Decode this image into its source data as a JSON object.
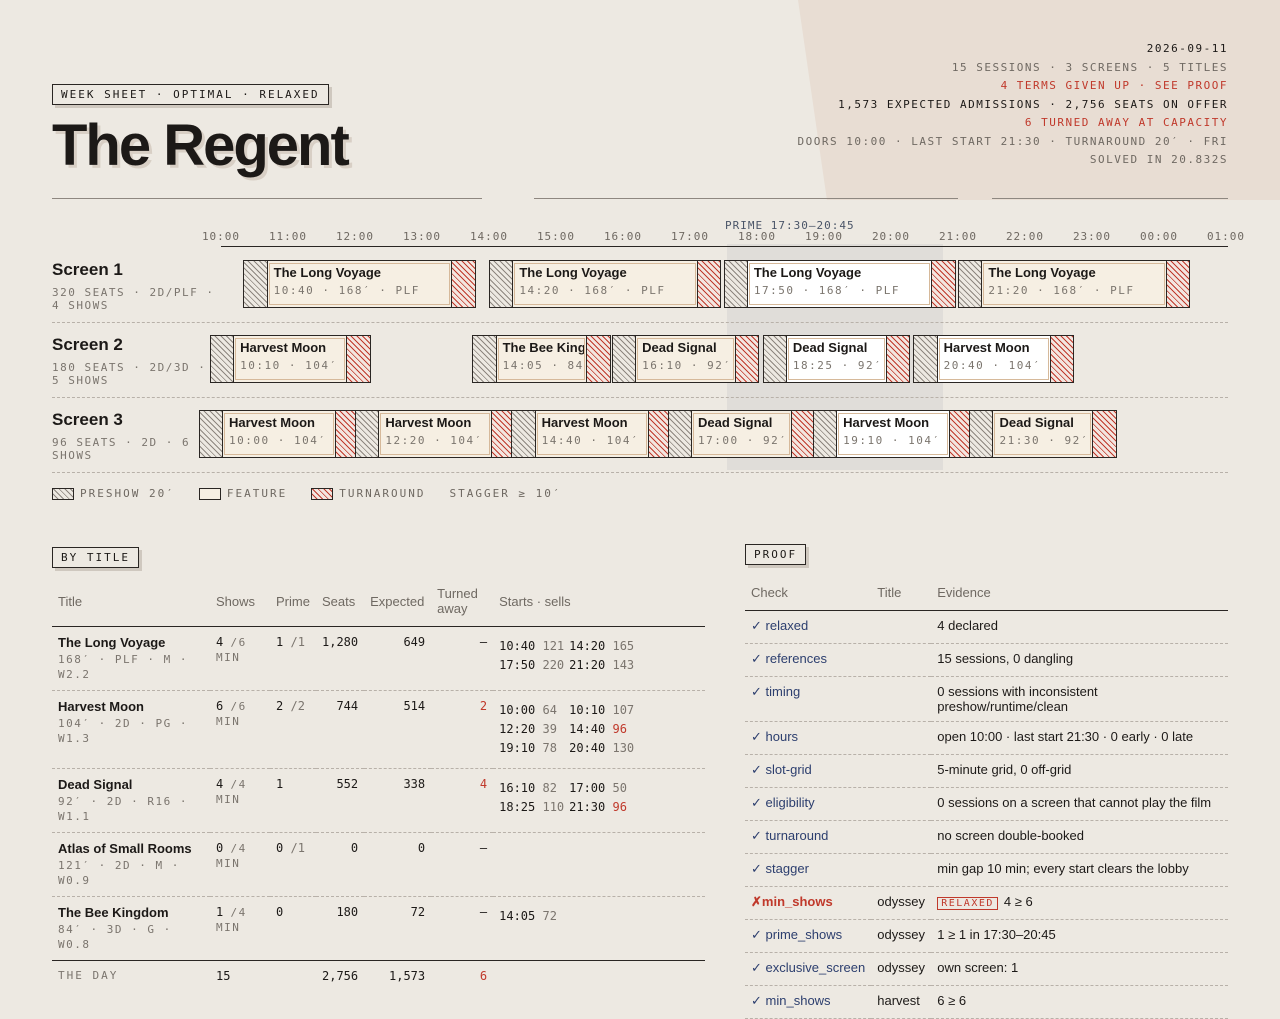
{
  "header": {
    "stamp": "WEEK SHEET · OPTIMAL · RELAXED",
    "title": "The Regent",
    "meta": [
      {
        "text": "2026-09-11",
        "tone": "dark"
      },
      {
        "text": "15 SESSIONS · 3 SCREENS · 5 TITLES",
        "tone": "grey"
      },
      {
        "text": "4 TERMS GIVEN UP · SEE PROOF",
        "tone": "red"
      },
      {
        "text": "1,573 EXPECTED ADMISSIONS · 2,756 SEATS ON OFFER",
        "tone": "mixed"
      },
      {
        "text": "6 TURNED AWAY AT CAPACITY",
        "tone": "red"
      },
      {
        "text": "DOORS 10:00 · LAST START 21:30 · TURNAROUND 20′ · FRI",
        "tone": "grey"
      },
      {
        "text": "SOLVED IN 20.832S",
        "tone": "grey"
      }
    ]
  },
  "timeline": {
    "ticks": [
      "10:00",
      "11:00",
      "12:00",
      "13:00",
      "14:00",
      "15:00",
      "16:00",
      "17:00",
      "18:00",
      "19:00",
      "20:00",
      "21:00",
      "22:00",
      "23:00",
      "00:00",
      "01:00"
    ],
    "prime_label": "PRIME 17:30–20:45",
    "screens": [
      {
        "name": "Screen 1",
        "info": "320 SEATS · 2D/PLF · 4 SHOWS",
        "sessions": [
          {
            "title": "The Long Voyage",
            "sub": "10:40 · 168′ · PLF",
            "start": "10:40",
            "runtime": 168
          },
          {
            "title": "The Long Voyage",
            "sub": "14:20 · 168′ · PLF",
            "start": "14:20",
            "runtime": 168
          },
          {
            "title": "The Long Voyage",
            "sub": "17:50 · 168′ · PLF",
            "start": "17:50",
            "runtime": 168
          },
          {
            "title": "The Long Voyage",
            "sub": "21:20 · 168′ · PLF",
            "start": "21:20",
            "runtime": 168
          }
        ]
      },
      {
        "name": "Screen 2",
        "info": "180 SEATS · 2D/3D · 5 SHOWS",
        "sessions": [
          {
            "title": "Harvest Moon",
            "sub": "10:10 · 104′",
            "start": "10:10",
            "runtime": 104
          },
          {
            "title": "The Bee King",
            "sub": "14:05 · 84′",
            "start": "14:05",
            "runtime": 84
          },
          {
            "title": "Dead Signal",
            "sub": "16:10 · 92′",
            "start": "16:10",
            "runtime": 92
          },
          {
            "title": "Dead Signal",
            "sub": "18:25 · 92′",
            "start": "18:25",
            "runtime": 92
          },
          {
            "title": "Harvest Moon",
            "sub": "20:40 · 104′",
            "start": "20:40",
            "runtime": 104
          }
        ]
      },
      {
        "name": "Screen 3",
        "info": "96 SEATS · 2D · 6 SHOWS",
        "sessions": [
          {
            "title": "Harvest Moon",
            "sub": "10:00 · 104′",
            "start": "10:00",
            "runtime": 104
          },
          {
            "title": "Harvest Moon",
            "sub": "12:20 · 104′",
            "start": "12:20",
            "runtime": 104
          },
          {
            "title": "Harvest Moon",
            "sub": "14:40 · 104′",
            "start": "14:40",
            "runtime": 104
          },
          {
            "title": "Dead Signal",
            "sub": "17:00 · 92′",
            "start": "17:00",
            "runtime": 92
          },
          {
            "title": "Harvest Moon",
            "sub": "19:10 · 104′",
            "start": "19:10",
            "runtime": 104
          },
          {
            "title": "Dead Signal",
            "sub": "21:30 · 92′",
            "start": "21:30",
            "runtime": 92
          }
        ]
      }
    ],
    "legend": {
      "preshow": "PRESHOW 20′",
      "feature": "FEATURE",
      "turnaround": "TURNAROUND",
      "stagger": "STAGGER ≥ 10′"
    }
  },
  "by_title": {
    "label": "BY TITLE",
    "columns": {
      "title": "Title",
      "shows": "Shows",
      "prime": "Prime",
      "seats": "Seats",
      "expected": "Expected",
      "turned": "Turned away",
      "starts": "Starts · sells"
    },
    "rows": [
      {
        "title": "The Long Voyage",
        "sub": "168′ · PLF · M · W2.2",
        "shows": "4",
        "shows_min": "/6 MIN",
        "prime": "1",
        "prime_min": "/1",
        "seats": "1,280",
        "expected": "649",
        "turned": "–",
        "starts": [
          [
            "10:40",
            "121"
          ],
          [
            "14:20",
            "165"
          ],
          [
            "17:50",
            "220"
          ],
          [
            "21:20",
            "143"
          ]
        ]
      },
      {
        "title": "Harvest Moon",
        "sub": "104′ · 2D · PG · W1.3",
        "shows": "6",
        "shows_min": "/6 MIN",
        "prime": "2",
        "prime_min": "/2",
        "seats": "744",
        "expected": "514",
        "turned": "2",
        "starts": [
          [
            "10:00",
            "64"
          ],
          [
            "10:10",
            "107"
          ],
          [
            "12:20",
            "39"
          ],
          [
            "14:40",
            "96"
          ],
          [
            "19:10",
            "78"
          ],
          [
            "20:40",
            "130"
          ]
        ]
      },
      {
        "title": "Dead Signal",
        "sub": "92′ · 2D · R16 · W1.1",
        "shows": "4",
        "shows_min": "/4 MIN",
        "prime": "1",
        "prime_min": "",
        "seats": "552",
        "expected": "338",
        "turned": "4",
        "starts": [
          [
            "16:10",
            "82"
          ],
          [
            "17:00",
            "50"
          ],
          [
            "18:25",
            "110"
          ],
          [
            "21:30",
            "96"
          ]
        ]
      },
      {
        "title": "Atlas of Small Rooms",
        "sub": "121′ · 2D · M · W0.9",
        "shows": "0",
        "shows_min": "/4 MIN",
        "prime": "0",
        "prime_min": "/1",
        "seats": "0",
        "expected": "0",
        "turned": "–",
        "starts": []
      },
      {
        "title": "The Bee Kingdom",
        "sub": "84′ · 3D · G · W0.8",
        "shows": "1",
        "shows_min": "/4 MIN",
        "prime": "0",
        "prime_min": "",
        "seats": "180",
        "expected": "72",
        "turned": "–",
        "starts": [
          [
            "14:05",
            "72"
          ]
        ]
      }
    ],
    "total": {
      "label": "THE DAY",
      "shows": "15",
      "seats": "2,756",
      "expected": "1,573",
      "turned": "6"
    }
  },
  "proof": {
    "label": "PROOF",
    "columns": {
      "check": "Check",
      "title": "Title",
      "evidence": "Evidence"
    },
    "rows": [
      {
        "ok": true,
        "check": "relaxed",
        "title": "",
        "evidence": "4 declared"
      },
      {
        "ok": true,
        "check": "references",
        "title": "",
        "evidence": "15 sessions, 0 dangling"
      },
      {
        "ok": true,
        "check": "timing",
        "title": "",
        "evidence": "0 sessions with inconsistent preshow/runtime/clean"
      },
      {
        "ok": true,
        "check": "hours",
        "title": "",
        "evidence": "open 10:00 · last start 21:30 · 0 early · 0 late"
      },
      {
        "ok": true,
        "check": "slot-grid",
        "title": "",
        "evidence": "5-minute grid, 0 off-grid"
      },
      {
        "ok": true,
        "check": "eligibility",
        "title": "",
        "evidence": "0 sessions on a screen that cannot play the film"
      },
      {
        "ok": true,
        "check": "turnaround",
        "title": "",
        "evidence": "no screen double-booked"
      },
      {
        "ok": true,
        "check": "stagger",
        "title": "",
        "evidence": "min gap 10 min; every start clears the lobby"
      },
      {
        "ok": false,
        "check": "min_shows",
        "title": "odyssey",
        "badge": "RELAXED",
        "evidence": "4 ≥ 6"
      },
      {
        "ok": true,
        "check": "prime_shows",
        "title": "odyssey",
        "evidence": "1 ≥ 1 in 17:30–20:45"
      },
      {
        "ok": true,
        "check": "exclusive_screen",
        "title": "odyssey",
        "evidence": "own screen: 1"
      },
      {
        "ok": true,
        "check": "min_shows",
        "title": "harvest",
        "evidence": "6 ≥ 6"
      }
    ]
  },
  "colors": {
    "accent_red": "#c0392b",
    "ink": "#1c1917",
    "paper": "#ede9e2",
    "check_blue": "#2c3e6e"
  }
}
